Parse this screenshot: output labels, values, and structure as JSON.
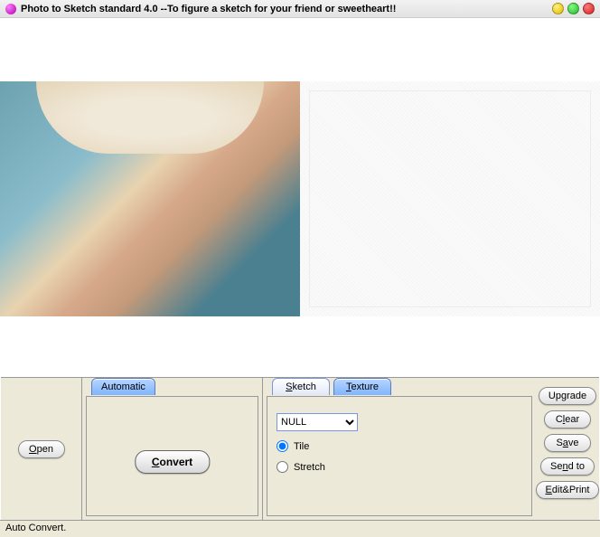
{
  "window": {
    "title": "Photo to Sketch standard 4.0 --To figure a sketch for your friend or sweetheart!!"
  },
  "buttons": {
    "open": "Open",
    "convert": "Convert",
    "upgrade": "Upgrade",
    "clear": "Clear",
    "save": "Save",
    "sendto": "Send to",
    "editprint": "Edit&Print"
  },
  "tabs": {
    "automatic": "Automatic",
    "sketch": "Sketch",
    "texture": "Texture"
  },
  "texture": {
    "select_value": "NULL",
    "tile": "Tile",
    "stretch": "Stretch"
  },
  "status": "Auto Convert."
}
